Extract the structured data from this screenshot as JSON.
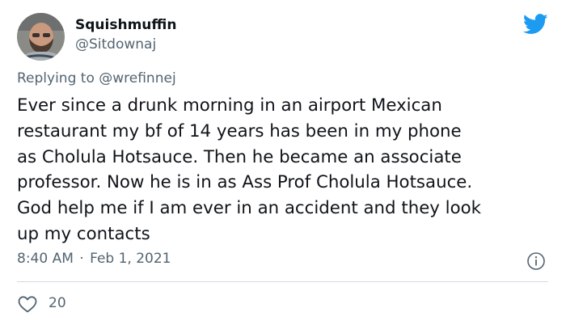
{
  "tweet": {
    "author": {
      "display_name": "Squishmuffin",
      "handle": "@Sitdownaj",
      "avatar_icon": "profile-photo"
    },
    "reply": {
      "prefix": "Replying to",
      "mention": "@wrefinnej"
    },
    "text_lines": [
      "Ever since a drunk morning in an airport Mexican",
      "restaurant my bf of 14 years has been in my phone",
      "as Cholula Hotsauce. Then he became an associate",
      "professor. Now he is in as Ass Prof Cholula Hotsauce.",
      "God help me if I am ever in an accident and they look",
      "up my contacts"
    ],
    "time": "8:40 AM",
    "separator": "·",
    "date": "Feb 1, 2021",
    "likes": "20",
    "icons": {
      "brand": "twitter-bird-icon",
      "info": "info-icon",
      "like": "heart-icon"
    },
    "colors": {
      "brand_blue": "#1d9bf0",
      "secondary_text": "#536471",
      "primary_text": "#0f1419",
      "divider": "#cfd9de"
    }
  }
}
